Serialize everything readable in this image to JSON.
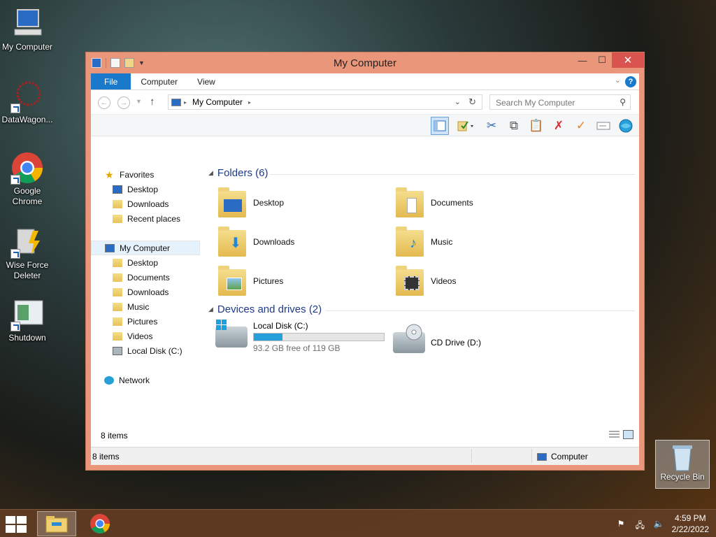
{
  "desktop": {
    "icons": [
      {
        "label": "My Computer",
        "icon": "computer-icon"
      },
      {
        "label": "DataWagon...",
        "icon": "datawagon-icon"
      },
      {
        "label": "Google Chrome",
        "icon": "chrome-icon"
      },
      {
        "label": "Wise Force Deleter",
        "icon": "wise-force-deleter-icon"
      },
      {
        "label": "Shutdown",
        "icon": "shutdown-icon"
      }
    ],
    "recycle_bin": {
      "label": "Recycle Bin"
    }
  },
  "window": {
    "title": "My Computer",
    "ribbon_tabs": [
      "File",
      "Computer",
      "View"
    ],
    "address": "My Computer",
    "search_placeholder": "Search My Computer",
    "nav": {
      "favorites": {
        "label": "Favorites",
        "items": [
          "Desktop",
          "Downloads",
          "Recent places"
        ]
      },
      "computer": {
        "label": "My Computer",
        "items": [
          "Desktop",
          "Documents",
          "Downloads",
          "Music",
          "Pictures",
          "Videos",
          "Local Disk (C:)"
        ]
      },
      "network": {
        "label": "Network"
      }
    },
    "folders": {
      "header": "Folders (6)",
      "items": [
        "Desktop",
        "Documents",
        "Downloads",
        "Music",
        "Pictures",
        "Videos"
      ]
    },
    "devices": {
      "header": "Devices and drives (2)",
      "local_disk": {
        "name": "Local Disk (C:)",
        "free_text": "93.2 GB free of 119 GB",
        "used_fraction": 0.22
      },
      "cd_drive": {
        "name": "CD Drive (D:)"
      }
    },
    "inner_status": "8 items",
    "status": {
      "count": "8 items",
      "location": "Computer"
    }
  },
  "taskbar": {
    "time": "4:59 PM",
    "date": "2/22/2022"
  },
  "colors": {
    "window_frame": "#e9967a",
    "close_button": "#d9534f",
    "file_tab": "#1979ca",
    "group_header": "#1e3a8a",
    "drive_bar": "#26a0da"
  }
}
